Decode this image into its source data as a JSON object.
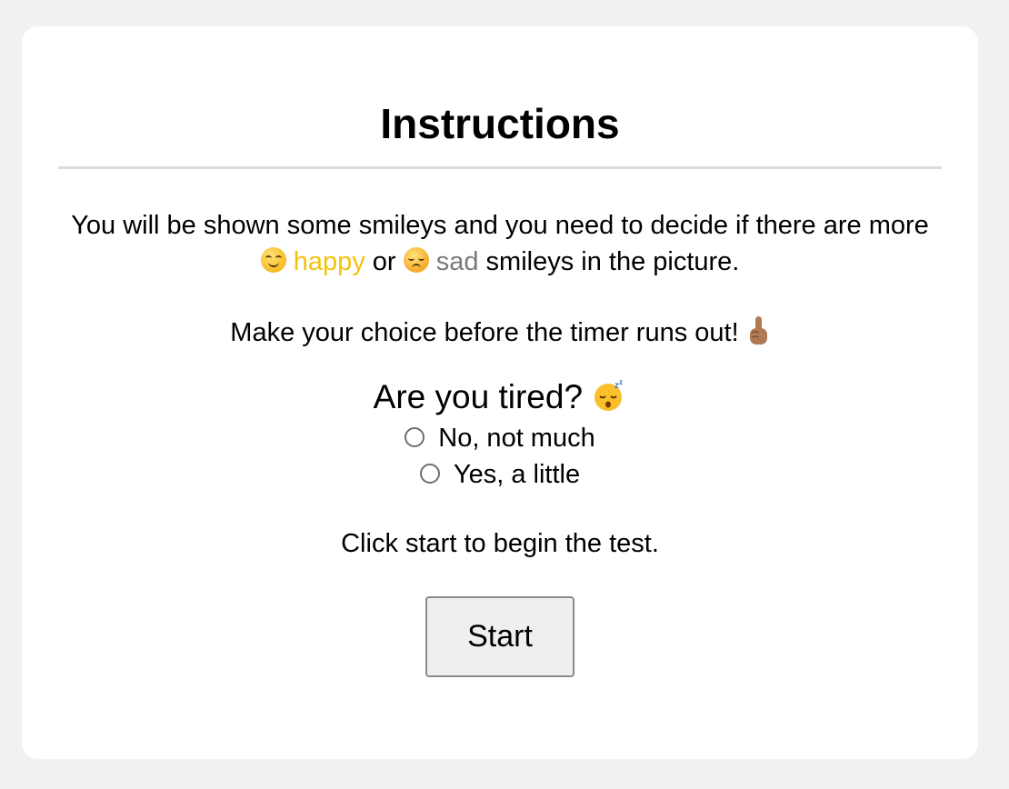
{
  "instructions": {
    "title": "Instructions",
    "line1_before": "You will be shown some smileys and you need to decide if there are more",
    "happy_word": "happy",
    "or_word": "or",
    "sad_word": "sad",
    "line1_after": "smileys in the picture.",
    "line2": "Make your choice before the timer runs out!",
    "happy_icon": "smiling-face-emoji",
    "sad_icon": "disappointed-face-emoji",
    "pointer_icon": "index-pointing-up-emoji",
    "happy_color": "#f4c20d",
    "sad_color": "#7a7a7a"
  },
  "survey": {
    "question": "Are you tired?",
    "question_icon": "sleeping-face-emoji",
    "options": [
      {
        "label": "No, not much",
        "selected": false
      },
      {
        "label": "Yes, a little",
        "selected": false
      }
    ]
  },
  "footer": {
    "prompt": "Click start to begin the test.",
    "start_label": "Start"
  }
}
